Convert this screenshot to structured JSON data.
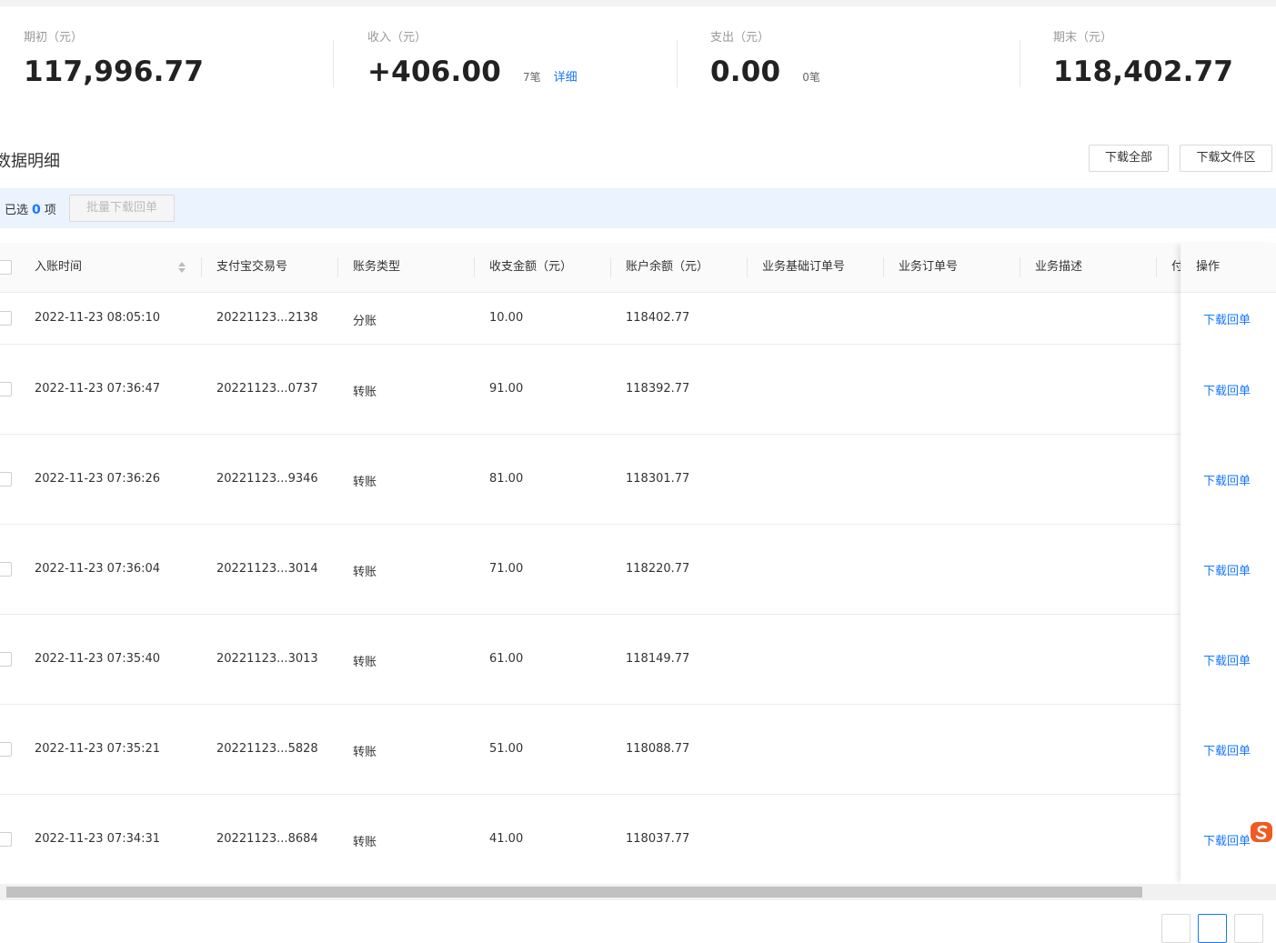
{
  "summary": {
    "opening": {
      "label": "期初（元）",
      "value": "117,996.77"
    },
    "income": {
      "label": "收入（元）",
      "value": "+406.00",
      "count": "7笔",
      "detail_link": "详细"
    },
    "expense": {
      "label": "支出（元）",
      "value": "0.00",
      "count": "0笔"
    },
    "closing": {
      "label": "期末（元）",
      "value": "118,402.77"
    }
  },
  "section": {
    "title": "数据明细",
    "download_all": "下载全部",
    "download_files": "下载文件区"
  },
  "selection": {
    "prefix": "已选",
    "count": "0",
    "suffix": "项",
    "batch_button": "批量下载回单"
  },
  "table": {
    "columns": [
      "入账时间",
      "支付宝交易号",
      "账务类型",
      "收支金额（元）",
      "账户余额（元）",
      "业务基础订单号",
      "业务订单号",
      "业务描述",
      "付"
    ],
    "action_header": "操作",
    "rows": [
      {
        "time": "2022-11-23 08:05:10",
        "trade_no": "20221123...2138",
        "type": "分账",
        "amount": "10.00",
        "balance": "118402.77",
        "action": "下载回单"
      },
      {
        "time": "2022-11-23 07:36:47",
        "trade_no": "20221123...0737",
        "type": "转账",
        "amount": "91.00",
        "balance": "118392.77",
        "action": "下载回单"
      },
      {
        "time": "2022-11-23 07:36:26",
        "trade_no": "20221123...9346",
        "type": "转账",
        "amount": "81.00",
        "balance": "118301.77",
        "action": "下载回单"
      },
      {
        "time": "2022-11-23 07:36:04",
        "trade_no": "20221123...3014",
        "type": "转账",
        "amount": "71.00",
        "balance": "118220.77",
        "action": "下载回单"
      },
      {
        "time": "2022-11-23 07:35:40",
        "trade_no": "20221123...3013",
        "type": "转账",
        "amount": "61.00",
        "balance": "118149.77",
        "action": "下载回单"
      },
      {
        "time": "2022-11-23 07:35:21",
        "trade_no": "20221123...5828",
        "type": "转账",
        "amount": "51.00",
        "balance": "118088.77",
        "action": "下载回单"
      },
      {
        "time": "2022-11-23 07:34:31",
        "trade_no": "20221123...8684",
        "type": "转账",
        "amount": "41.00",
        "balance": "118037.77",
        "action": "下载回单"
      }
    ]
  },
  "icons": {
    "sort": "sort-icon",
    "ime": "sogou-ime-icon"
  },
  "colors": {
    "accent": "#1677ff",
    "selection_bar": "#ebf3ff",
    "ime_brand": "#f05a22"
  }
}
